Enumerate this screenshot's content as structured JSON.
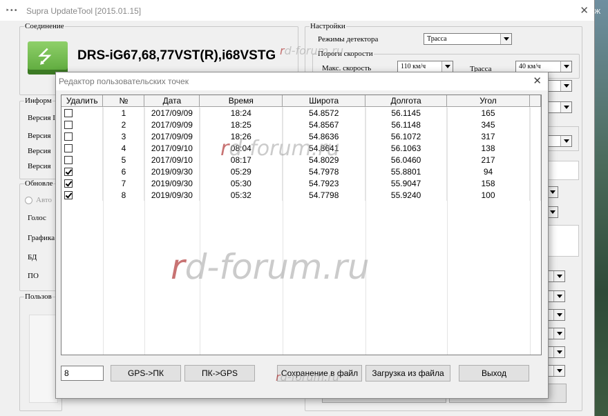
{
  "app": {
    "title": "Supra UpdateTool [2015.01.15]",
    "close_label": "✕",
    "icon_label": "‣••"
  },
  "connection": {
    "legend": "Соединение",
    "model": "DRS-iG67,68,77VST(R),i68VSTG"
  },
  "info": {
    "legend": "Информ",
    "rows": [
      "Версия I",
      "Версия",
      "Версия",
      "Версия"
    ]
  },
  "updates": {
    "legend": "Обновле",
    "auto_label": "Авто",
    "rows": [
      "Голос",
      "Графика",
      "БД",
      "ПО"
    ]
  },
  "user_points": {
    "legend": "Пользов"
  },
  "settings": {
    "legend": "Настройки",
    "detector_mode_label": "Режимы детектора",
    "detector_mode_value": "Трасса",
    "speed_thresholds_legend": "Пороги скорости",
    "max_speed_label": "Макс. скорость",
    "max_speed_value": "110 км/ч",
    "highway_label": "Трасса",
    "highway_value": "40 км/ч"
  },
  "dialog": {
    "title": "Редактор пользовательских точек",
    "close_label": "✕",
    "columns": [
      "Удалить",
      "№",
      "Дата",
      "Время",
      "Широта",
      "Долгота",
      "Угол"
    ],
    "rows": [
      {
        "checked": false,
        "num": "1",
        "date": "2017/09/09",
        "time": "18:24",
        "lat": "54.8572",
        "lon": "56.1145",
        "angle": "165"
      },
      {
        "checked": false,
        "num": "2",
        "date": "2017/09/09",
        "time": "18:25",
        "lat": "54.8567",
        "lon": "56.1148",
        "angle": "345"
      },
      {
        "checked": false,
        "num": "3",
        "date": "2017/09/09",
        "time": "18:26",
        "lat": "54.8636",
        "lon": "56.1072",
        "angle": "317"
      },
      {
        "checked": false,
        "num": "4",
        "date": "2017/09/10",
        "time": "08:04",
        "lat": "54.8641",
        "lon": "56.1063",
        "angle": "138"
      },
      {
        "checked": false,
        "num": "5",
        "date": "2017/09/10",
        "time": "08:17",
        "lat": "54.8029",
        "lon": "56.0460",
        "angle": "217"
      },
      {
        "checked": true,
        "num": "6",
        "date": "2019/09/30",
        "time": "05:29",
        "lat": "54.7978",
        "lon": "55.8801",
        "angle": "94"
      },
      {
        "checked": true,
        "num": "7",
        "date": "2019/09/30",
        "time": "05:30",
        "lat": "54.7923",
        "lon": "55.9047",
        "angle": "158"
      },
      {
        "checked": true,
        "num": "8",
        "date": "2019/09/30",
        "time": "05:32",
        "lat": "54.7798",
        "lon": "55.9240",
        "angle": "100"
      }
    ],
    "count_value": "8",
    "buttons": {
      "gps_to_pc": "GPS->ПК",
      "pc_to_gps": "ПК->GPS",
      "save_file": "Сохранение в файл",
      "load_file": "Загрузка из файла",
      "exit": "Выход"
    }
  },
  "watermarks": {
    "r": "r",
    "rest": "d-forum.ru"
  },
  "colors": {
    "watermark_accent": "#aa2828",
    "usb_green": "#5aa73a"
  }
}
